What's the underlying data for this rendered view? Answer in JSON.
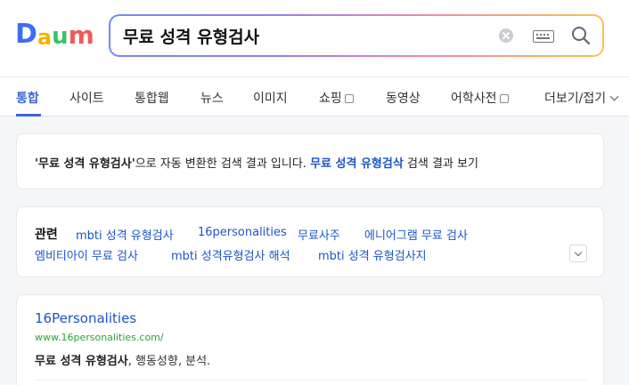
{
  "logo": {
    "letters": [
      {
        "char": "D",
        "color": "#3b6ff0"
      },
      {
        "char": "a",
        "color": "#f5b400"
      },
      {
        "char": "u",
        "color": "#3ac26d"
      },
      {
        "char": "m",
        "color": "#f05a5a"
      }
    ]
  },
  "search": {
    "query": "무료 성격 유형검사"
  },
  "tabs": [
    {
      "label": "통합",
      "active": true
    },
    {
      "label": "사이트"
    },
    {
      "label": "통합웹"
    },
    {
      "label": "뉴스"
    },
    {
      "label": "이미지"
    },
    {
      "label": "쇼핑"
    },
    {
      "label": "동영상"
    },
    {
      "label": "어학사전"
    },
    {
      "label": "더보기/접기"
    }
  ],
  "notice": {
    "original_query": "'무료 성격 유형검사'",
    "middle_text": "으로 자동 변환한 검색 결과 입니다. ",
    "alt_query": "무료 성격 유형검삭",
    "tail_text": " 검색 결과 보기"
  },
  "related": {
    "label": "관련",
    "items": [
      "mbti 성격 유형검사",
      "16personalities",
      "무료사주",
      "에니어그램 무료 검사",
      "엠비티아이 무료 검사",
      "mbti 성격유형검사 해석",
      "mbti 성격 유형검사지"
    ]
  },
  "result": {
    "title": "16Personalities",
    "url": "www.16personalities.com/",
    "desc_bold": "무료 성격 유형검사",
    "desc_rest": ", 행동성향, 분석."
  },
  "colors": {
    "accent": "#3b66d6",
    "link": "#1a56c8",
    "url_green": "#2aa33a"
  }
}
